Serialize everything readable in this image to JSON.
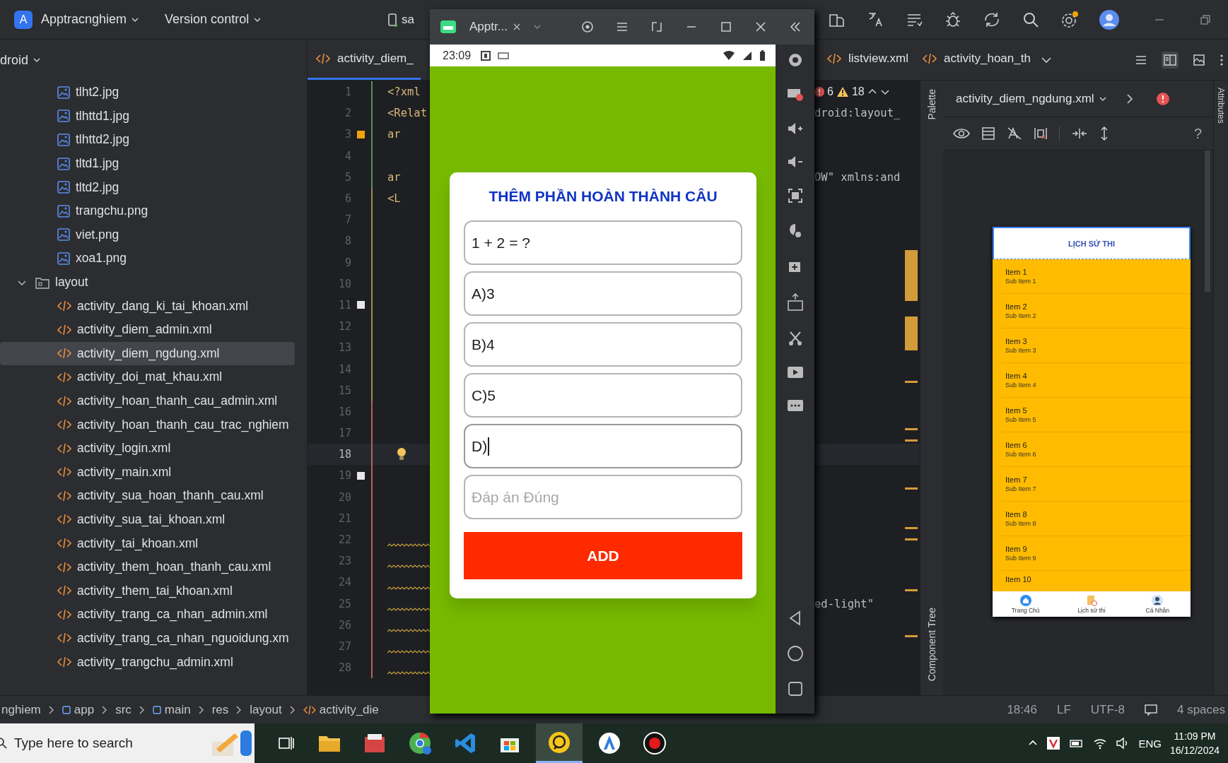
{
  "top_bar": {
    "badge": "A",
    "project": "Apptracnghiem",
    "vcs": "Version control",
    "device": "sa"
  },
  "tree": {
    "header": "droid",
    "items": [
      {
        "name": "tlht2.jpg",
        "kind": "image",
        "selected": false
      },
      {
        "name": "tlhttd1.jpg",
        "kind": "image",
        "selected": false
      },
      {
        "name": "tlhttd2.jpg",
        "kind": "image",
        "selected": false
      },
      {
        "name": "tltd1.jpg",
        "kind": "image",
        "selected": false
      },
      {
        "name": "tltd2.jpg",
        "kind": "image",
        "selected": false
      },
      {
        "name": "trangchu.png",
        "kind": "image",
        "selected": false
      },
      {
        "name": "viet.png",
        "kind": "image",
        "selected": false
      },
      {
        "name": "xoa1.png",
        "kind": "image",
        "selected": false
      },
      {
        "name": "layout",
        "kind": "folder",
        "selected": false,
        "expanded": true,
        "children": [
          {
            "name": "activity_dang_ki_tai_khoan.xml",
            "kind": "xml",
            "selected": false
          },
          {
            "name": "activity_diem_admin.xml",
            "kind": "xml",
            "selected": false
          },
          {
            "name": "activity_diem_ngdung.xml",
            "kind": "xml",
            "selected": true
          },
          {
            "name": "activity_doi_mat_khau.xml",
            "kind": "xml",
            "selected": false
          },
          {
            "name": "activity_hoan_thanh_cau_admin.xml",
            "kind": "xml",
            "selected": false
          },
          {
            "name": "activity_hoan_thanh_cau_trac_nghiem",
            "kind": "xml",
            "selected": false
          },
          {
            "name": "activity_login.xml",
            "kind": "xml",
            "selected": false
          },
          {
            "name": "activity_main.xml",
            "kind": "xml",
            "selected": false
          },
          {
            "name": "activity_sua_hoan_thanh_cau.xml",
            "kind": "xml",
            "selected": false
          },
          {
            "name": "activity_sua_tai_khoan.xml",
            "kind": "xml",
            "selected": false
          },
          {
            "name": "activity_tai_khoan.xml",
            "kind": "xml",
            "selected": false
          },
          {
            "name": "activity_them_hoan_thanh_cau.xml",
            "kind": "xml",
            "selected": false
          },
          {
            "name": "activity_them_tai_khoan.xml",
            "kind": "xml",
            "selected": false
          },
          {
            "name": "activity_trang_ca_nhan_admin.xml",
            "kind": "xml",
            "selected": false
          },
          {
            "name": "activity_trang_ca_nhan_nguoidung.xm",
            "kind": "xml",
            "selected": false
          },
          {
            "name": "activity_trangchu_admin.xml",
            "kind": "xml",
            "selected": false
          }
        ]
      }
    ]
  },
  "editor_tabs": [
    {
      "label": "activity_diem_",
      "selected": true
    },
    {
      "label": "listview.xml",
      "selected": false
    },
    {
      "label": "activity_hoan_th",
      "selected": false
    }
  ],
  "code_lines": [
    {
      "number": "1",
      "left": "<?xml",
      "current": false,
      "wavy": false,
      "problems": {
        "errors": "6",
        "warnings": "18"
      }
    },
    {
      "number": "2",
      "left": "<Relat",
      "right": "droid:layout_",
      "current": false,
      "wavy": false
    },
    {
      "number": "3",
      "left": "ar",
      "color": "#f0a30a",
      "current": false,
      "wavy": false
    },
    {
      "number": "4",
      "current": false,
      "wavy": false
    },
    {
      "number": "5",
      "left": "ar",
      "right": "OW\" xmlns:and",
      "current": false,
      "wavy": false
    },
    {
      "number": "6",
      "left": "<L",
      "current": false,
      "wavy": false
    },
    {
      "number": "7",
      "current": false,
      "wavy": false
    },
    {
      "number": "8",
      "current": false,
      "wavy": false
    },
    {
      "number": "9",
      "current": false,
      "wavy": false
    },
    {
      "number": "10",
      "current": false,
      "wavy": false
    },
    {
      "number": "11",
      "color": "#e8e8e8",
      "current": false,
      "wavy": false
    },
    {
      "number": "12",
      "current": false,
      "wavy": false
    },
    {
      "number": "13",
      "current": false,
      "wavy": false
    },
    {
      "number": "14",
      "current": false,
      "wavy": false
    },
    {
      "number": "15",
      "current": false,
      "wavy": false
    },
    {
      "number": "16",
      "current": false,
      "wavy": false
    },
    {
      "number": "17",
      "current": false,
      "wavy": false
    },
    {
      "number": "18",
      "current": true,
      "wavy": false,
      "kind": "hint"
    },
    {
      "number": "19",
      "color": "#e8e8e8",
      "current": false,
      "wavy": false
    },
    {
      "number": "20",
      "current": false,
      "wavy": false
    },
    {
      "number": "21",
      "current": false,
      "wavy": false
    },
    {
      "number": "22",
      "current": false,
      "wavy": true
    },
    {
      "number": "23",
      "current": false,
      "wavy": true
    },
    {
      "number": "24",
      "current": false,
      "wavy": true
    },
    {
      "number": "25",
      "right": "ed-light\"",
      "current": false,
      "wavy": true
    },
    {
      "number": "26",
      "current": false,
      "wavy": true
    },
    {
      "number": "27",
      "current": false,
      "wavy": true
    },
    {
      "number": "28",
      "current": false,
      "wavy": true
    }
  ],
  "emulator": {
    "tab": "Apptr...",
    "clock": "23:09",
    "form": {
      "title": "THÊM PHẦN HOÀN THÀNH CÂU",
      "fields": [
        {
          "value": "1 + 2 = ?",
          "focused": false
        },
        {
          "value": "A)3",
          "focused": false
        },
        {
          "value": "B)4",
          "focused": false
        },
        {
          "value": "C)5",
          "focused": false
        },
        {
          "value": "D)",
          "focused": true
        },
        {
          "placeholder": "Đáp án Đúng",
          "focused": false
        }
      ],
      "button": "ADD"
    }
  },
  "side_strips": {
    "palette": "Palette",
    "component_tree": "Component Tree",
    "attributes": "Attributes"
  },
  "design": {
    "file": "activity_diem_ngdung.xml",
    "help": "?",
    "preview": {
      "header": "LỊCH SỬ THI",
      "items": [
        {
          "title": "Item 1",
          "subtitle": "Sub Item 1"
        },
        {
          "title": "Item 2",
          "subtitle": "Sub Item 2"
        },
        {
          "title": "Item 3",
          "subtitle": "Sub Item 3"
        },
        {
          "title": "Item 4",
          "subtitle": "Sub Item 4"
        },
        {
          "title": "Item 5",
          "subtitle": "Sub Item 5"
        },
        {
          "title": "Item 6",
          "subtitle": "Sub Item 6"
        },
        {
          "title": "Item 7",
          "subtitle": "Sub Item 7"
        },
        {
          "title": "Item 8",
          "subtitle": "Sub Item 8"
        },
        {
          "title": "Item 9",
          "subtitle": "Sub Item 9"
        },
        {
          "title": "Item 10"
        }
      ],
      "nav": [
        {
          "label": "Trang Chủ",
          "kind": "home"
        },
        {
          "label": "Lịch sử thi",
          "kind": "history"
        },
        {
          "label": "Cá Nhân",
          "kind": "profile"
        }
      ]
    }
  },
  "breadcrumbs": [
    {
      "label": "nghiem",
      "kind": "text"
    },
    {
      "label": "app",
      "kind": "module"
    },
    {
      "label": "src",
      "kind": "text"
    },
    {
      "label": "main",
      "kind": "module"
    },
    {
      "label": "res",
      "kind": "text"
    },
    {
      "label": "layout",
      "kind": "text"
    },
    {
      "label": "activity_die",
      "kind": "xml"
    }
  ],
  "status": {
    "position": "18:46",
    "line_ending": "LF",
    "encoding": "UTF-8",
    "indent": "4 spaces"
  },
  "taskbar": {
    "search_placeholder": "Type here to search",
    "language": "ENG",
    "time": "11:09 PM",
    "date": "16/12/2024"
  }
}
